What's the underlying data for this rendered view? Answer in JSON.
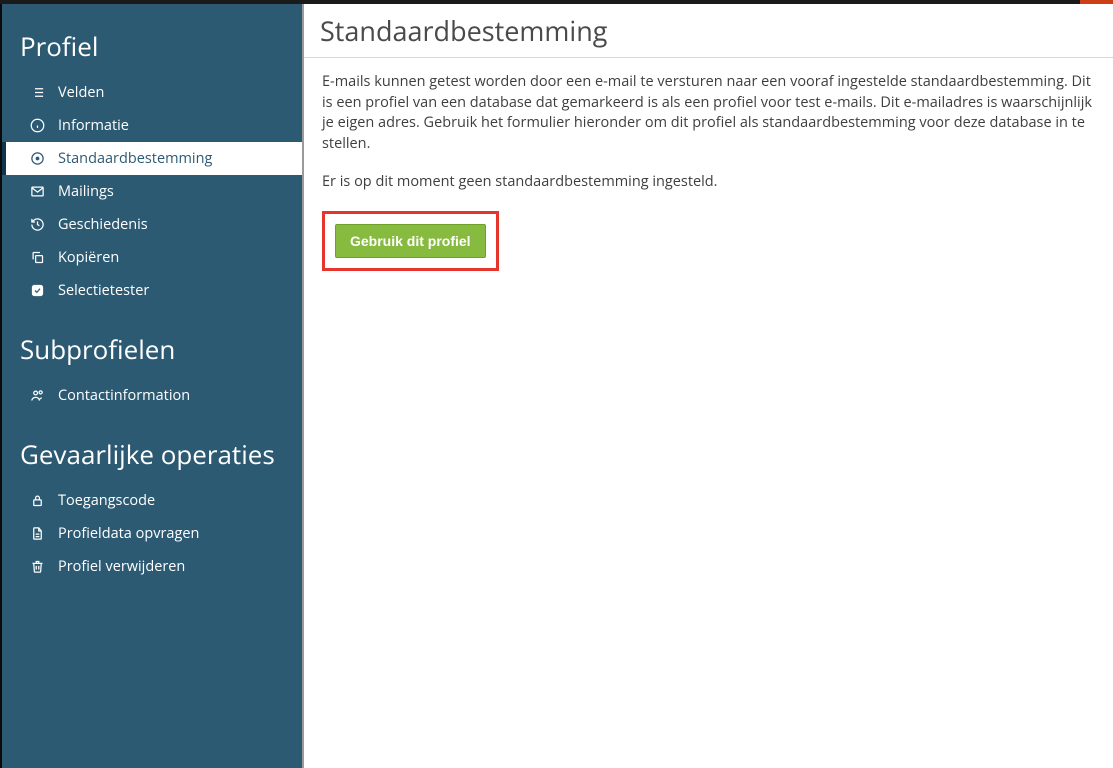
{
  "sidebar": {
    "sections": [
      {
        "title": "Profiel",
        "items": [
          {
            "icon": "list",
            "label": "Velden"
          },
          {
            "icon": "info",
            "label": "Informatie"
          },
          {
            "icon": "target",
            "label": "Standaardbestemming",
            "active": true
          },
          {
            "icon": "envelope",
            "label": "Mailings"
          },
          {
            "icon": "history",
            "label": "Geschiedenis"
          },
          {
            "icon": "copy",
            "label": "Kopiëren"
          },
          {
            "icon": "check-square",
            "label": "Selectietester"
          }
        ]
      },
      {
        "title": "Subprofielen",
        "items": [
          {
            "icon": "users",
            "label": "Contactinformation"
          }
        ]
      },
      {
        "title": "Gevaarlijke operaties",
        "items": [
          {
            "icon": "lock",
            "label": "Toegangscode"
          },
          {
            "icon": "file-text",
            "label": "Profieldata opvragen"
          },
          {
            "icon": "trash",
            "label": "Profiel verwijderen"
          }
        ]
      }
    ]
  },
  "main": {
    "title": "Standaardbestemming",
    "intro": "E-mails kunnen getest worden door een e-mail te versturen naar een vooraf ingestelde standaardbestemming. Dit is een profiel van een database dat gemarkeerd is als een profiel voor test e-mails. Dit e-mailadres is waarschijnlijk je eigen adres. Gebruik het formulier hieronder om dit profiel als standaardbestemming voor deze database in te stellen.",
    "status": "Er is op dit moment geen standaardbestemming ingesteld.",
    "cta": "Gebruik dit profiel"
  }
}
